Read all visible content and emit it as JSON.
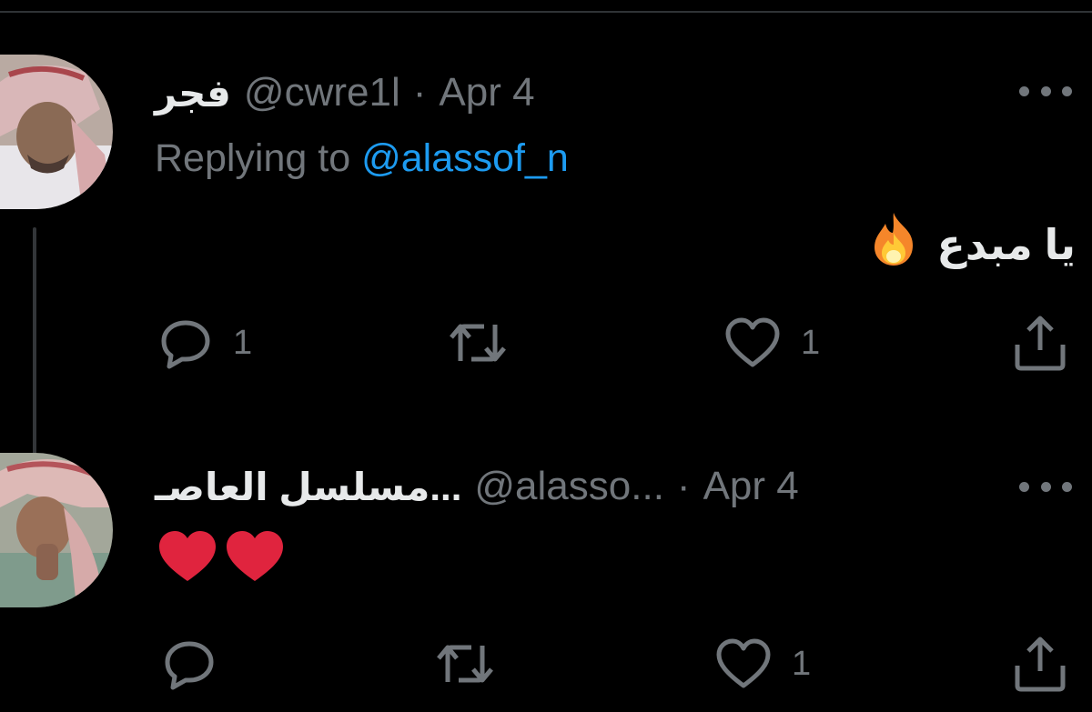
{
  "tweets": [
    {
      "display_name": "فجر",
      "handle": "@cwre1l",
      "separator": "·",
      "time": "Apr 4",
      "replying_prefix": "Replying to ",
      "replying_to": "@alassof_n",
      "text": "يا مبدع",
      "emoji": "fire",
      "actions": {
        "reply_count": "1",
        "retweet_count": "",
        "like_count": "1"
      }
    },
    {
      "display_name": "مسلسل العاصـ...",
      "handle": "@alasso...",
      "separator": "·",
      "time": "Apr 4",
      "emoji": "two red hearts",
      "actions": {
        "reply_count": "",
        "retweet_count": "",
        "like_count": "1"
      }
    }
  ],
  "icons": [
    "more-icon",
    "reply-icon",
    "retweet-icon",
    "like-icon",
    "share-icon"
  ],
  "colors": {
    "background": "#000000",
    "primary_text": "#e7e9ea",
    "secondary_text": "#71767b",
    "mention": "#1d9bf0",
    "heart": "#e0243e",
    "divider": "#2f3336"
  }
}
